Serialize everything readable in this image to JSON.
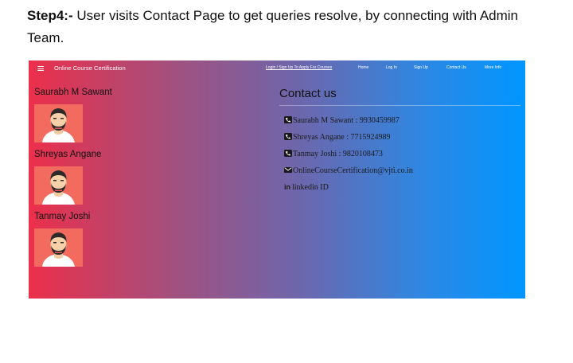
{
  "caption": {
    "step": "Step4:-",
    "text": " User visits Contact Page to get queries resolve, by connecting with Admin Team."
  },
  "nav": {
    "brand": "Online Course Certification",
    "links": [
      "Login / Sign Up To Apply For Courses",
      "Home",
      "Log In",
      "Sign Up",
      "Contact Us",
      "More Info"
    ]
  },
  "team": [
    {
      "name": "Saurabh M Sawant",
      "avatar_icon": "man-avatar-icon"
    },
    {
      "name": "Shreyas Angane",
      "avatar_icon": "man-avatar-icon"
    },
    {
      "name": "Tanmay Joshi",
      "avatar_icon": "man-avatar-icon"
    }
  ],
  "contact": {
    "title": "Contact us",
    "phones": [
      "Saurabh M Sawant : 9930459987",
      "Shreyas Angane : 7715924989",
      "Tanmay Joshi : 9820108473"
    ],
    "email": "OnlineCourseCertification@vjti.co.in",
    "linkedin_icon": "in",
    "linkedin": "linkedin ID"
  },
  "colors": {
    "gradient_start": "#ec2f4b",
    "gradient_end": "#0096ff",
    "avatar_bg": "#f26b5e"
  }
}
